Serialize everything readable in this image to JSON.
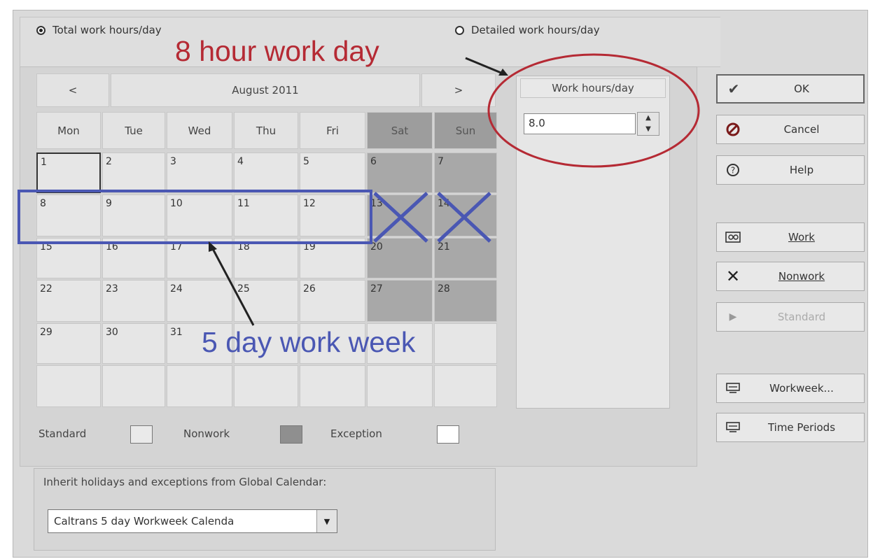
{
  "radio": {
    "total_label": "Total work hours/day",
    "detailed_label": "Detailed work hours/day",
    "selected": "total"
  },
  "calendar": {
    "prev": "<",
    "next": ">",
    "month": "August 2011",
    "days": [
      "Mon",
      "Tue",
      "Wed",
      "Thu",
      "Fri",
      "Sat",
      "Sun"
    ],
    "dates": [
      [
        "1",
        "2",
        "3",
        "4",
        "5",
        "6",
        "7"
      ],
      [
        "8",
        "9",
        "10",
        "11",
        "12",
        "13",
        "14"
      ],
      [
        "15",
        "16",
        "17",
        "18",
        "19",
        "20",
        "21"
      ],
      [
        "22",
        "23",
        "24",
        "25",
        "26",
        "27",
        "28"
      ],
      [
        "29",
        "30",
        "31",
        "",
        "",
        "",
        ""
      ],
      [
        "",
        "",
        "",
        "",
        "",
        "",
        ""
      ]
    ]
  },
  "work_hours": {
    "header": "Work hours/day",
    "value": "8.0"
  },
  "buttons": {
    "ok": "OK",
    "cancel": "Cancel",
    "help": "Help",
    "work": "Work",
    "nonwork": "Nonwork",
    "standard": "Standard",
    "workweek": "Workweek...",
    "time_periods": "Time Periods"
  },
  "legend": {
    "standard": "Standard",
    "nonwork": "Nonwork",
    "exception": "Exception"
  },
  "inherit": {
    "label": "Inherit holidays and exceptions from Global Calendar:",
    "value": "Caltrans 5 day  Workweek Calenda"
  },
  "annotations": {
    "eight_hour": "8 hour work day",
    "five_day": "5 day work week"
  },
  "colors": {
    "annotation_red": "#b52a34",
    "annotation_blue": "#4a57b3",
    "nonwork_gray": "#a8a8a8"
  }
}
